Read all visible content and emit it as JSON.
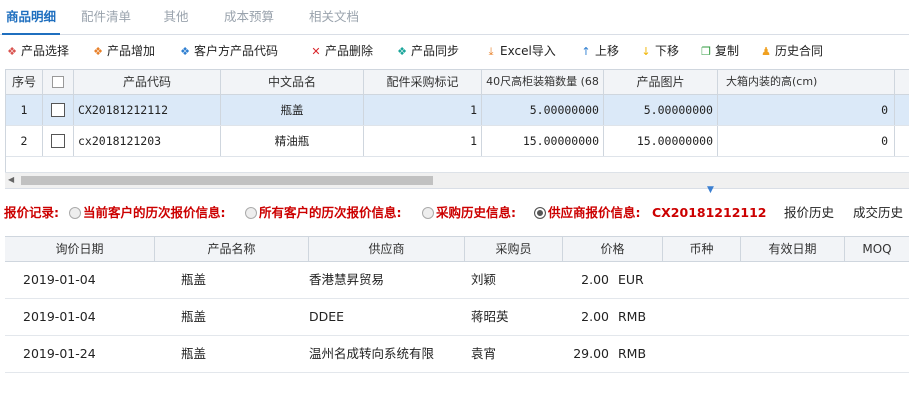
{
  "tabs": [
    "商品明细",
    "配件清单",
    "其他",
    "成本预算",
    "相关文档"
  ],
  "toolbar": [
    {
      "label": "产品选择",
      "icon": "box-red-icon",
      "color": "#d9534f",
      "glyph": "❖"
    },
    {
      "label": "产品增加",
      "icon": "box-orange-icon",
      "color": "#e8812a",
      "glyph": "❖"
    },
    {
      "label": "客户方产品代码",
      "icon": "box-blue-icon",
      "color": "#2f7fd1",
      "glyph": "❖"
    },
    {
      "label": "产品删除",
      "icon": "delete-x-icon",
      "color": "#d9262c",
      "glyph": "✕"
    },
    {
      "label": "产品同步",
      "icon": "box-teal-icon",
      "color": "#1aa59a",
      "glyph": "❖"
    },
    {
      "label": "Excel导入",
      "icon": "import-icon",
      "color": "#e8812a",
      "glyph": "⤓"
    },
    {
      "label": "上移",
      "icon": "arrow-up-icon",
      "color": "#2f7fd1",
      "glyph": "↑"
    },
    {
      "label": "下移",
      "icon": "arrow-down-icon",
      "color": "#f0b400",
      "glyph": "↓"
    },
    {
      "label": "复制",
      "icon": "copy-icon",
      "color": "#2e9a3e",
      "glyph": "❐"
    },
    {
      "label": "历史合同",
      "icon": "history-user-icon",
      "color": "#f0a020",
      "glyph": "♟"
    }
  ],
  "product_grid": {
    "headers": [
      "序号",
      "",
      "产品代码",
      "中文品名",
      "配件采购标记",
      "40尺高柜装箱数量 (68",
      "产品图片",
      "大箱内装的高(cm)"
    ],
    "rows": [
      {
        "seq": "1",
        "code": "CX20181212112",
        "name": "瓶盖",
        "mark": "1",
        "qty40": "5.00000000",
        "image": "5.00000000",
        "height": "0"
      },
      {
        "seq": "2",
        "code": "cx2018121203",
        "name": "精油瓶",
        "mark": "1",
        "qty40": "15.00000000",
        "image": "15.00000000",
        "height": "0"
      }
    ]
  },
  "quote": {
    "label": "报价记录:",
    "options": [
      "当前客户的历次报价信息:",
      "所有客户的历次报价信息:",
      "采购历史信息:",
      "供应商报价信息:"
    ],
    "selected_code": "CX20181212112",
    "buttons": [
      "报价历史",
      "成交历史"
    ]
  },
  "history_grid": {
    "headers": [
      "询价日期",
      "产品名称",
      "供应商",
      "采购员",
      "价格",
      "币种",
      "有效日期",
      "MOQ"
    ],
    "rows": [
      {
        "date": "2019-01-04",
        "product": "瓶盖",
        "supplier": "香港慧昇贸易",
        "buyer": "刘颖",
        "price": "2.00",
        "currency": "EUR"
      },
      {
        "date": "2019-01-04",
        "product": "瓶盖",
        "supplier": "DDEE",
        "buyer": "蒋昭英",
        "price": "2.00",
        "currency": "RMB"
      },
      {
        "date": "2019-01-24",
        "product": "瓶盖",
        "supplier": "温州名成转向系统有限",
        "buyer": "袁宵",
        "price": "29.00",
        "currency": "RMB"
      }
    ]
  }
}
